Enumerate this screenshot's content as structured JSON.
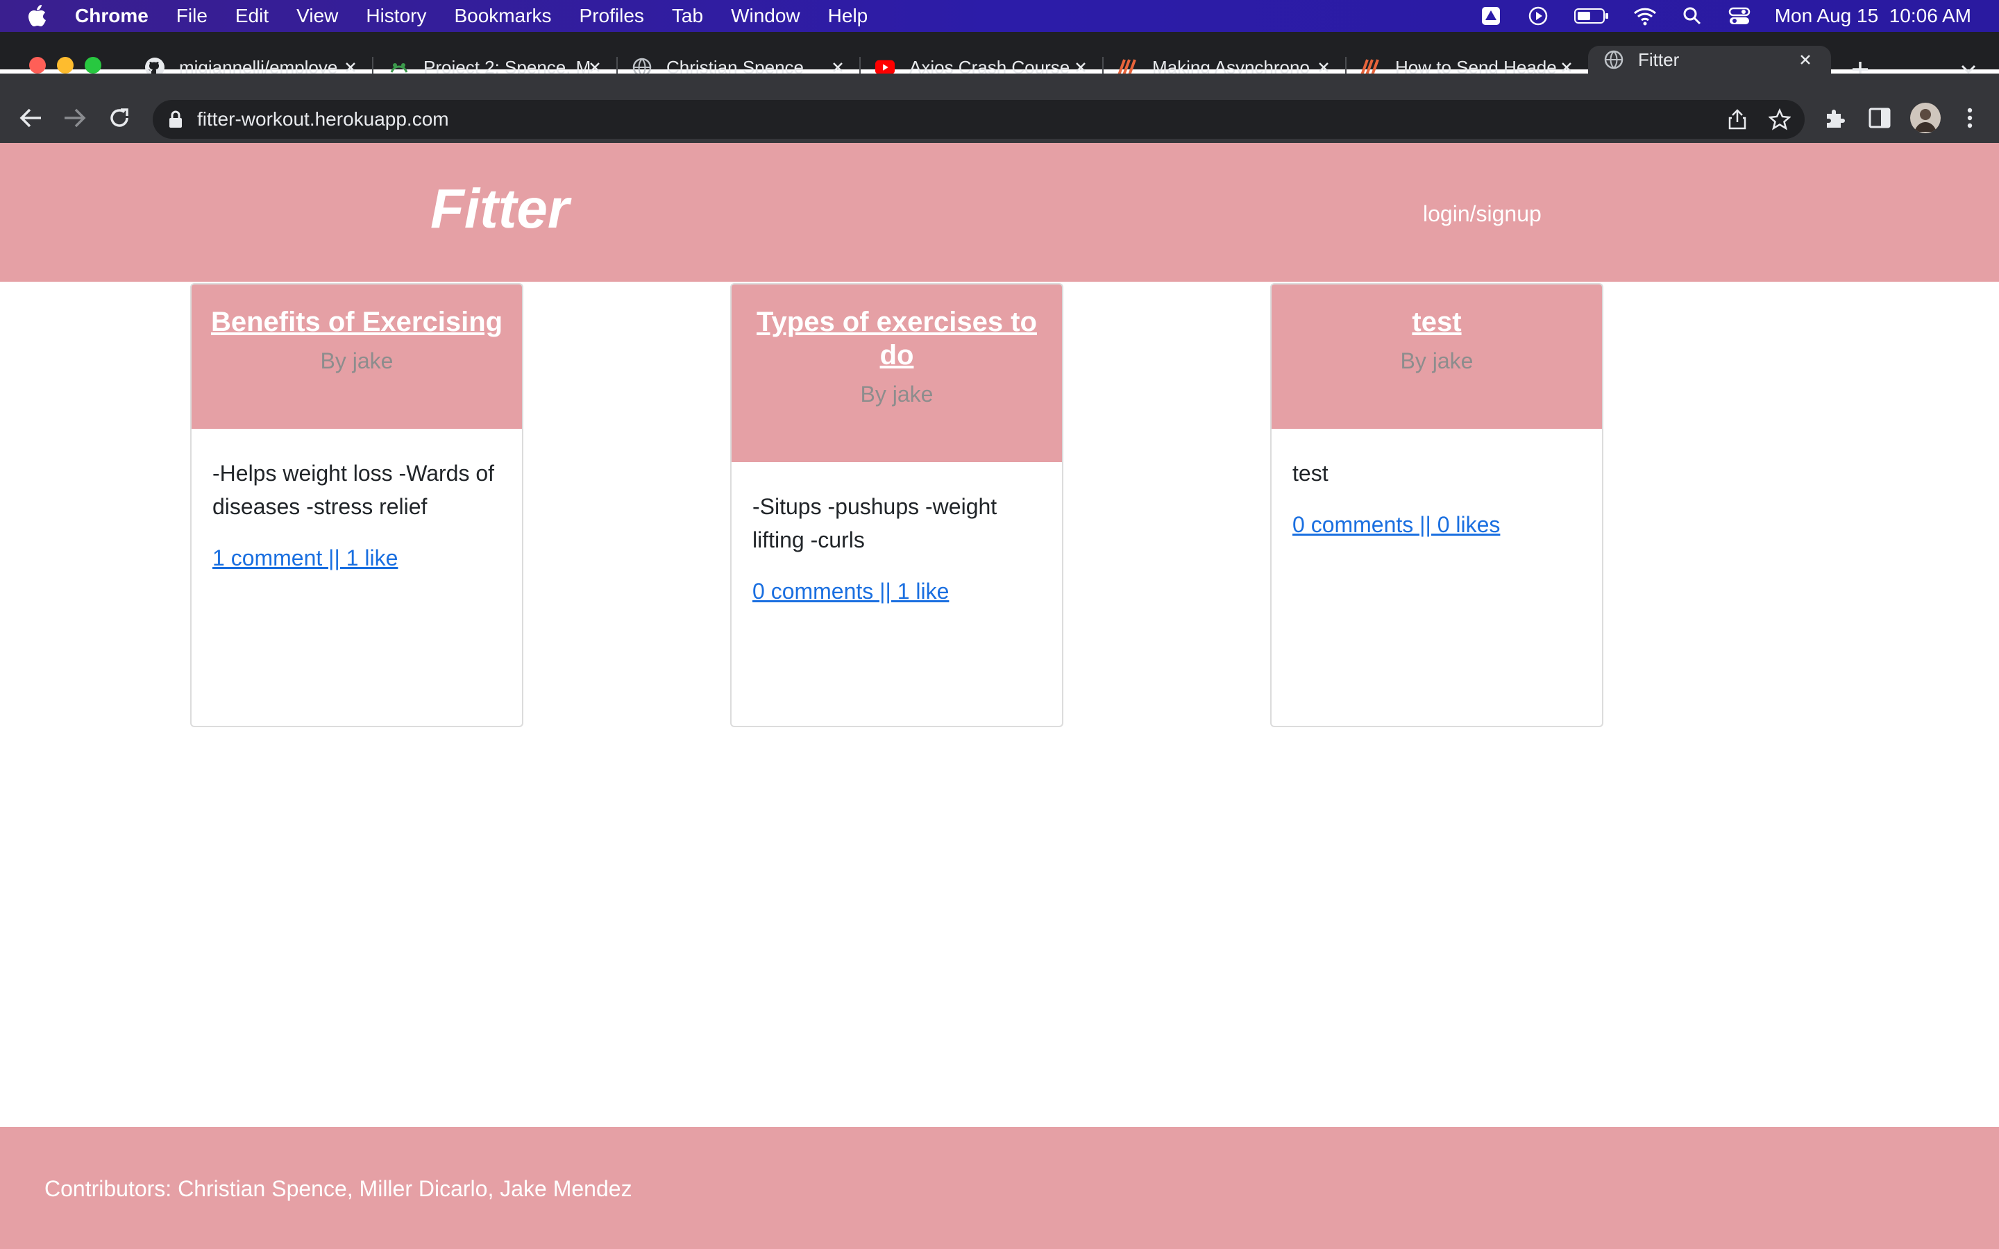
{
  "menubar": {
    "app": "Chrome",
    "items": [
      "File",
      "Edit",
      "View",
      "History",
      "Bookmarks",
      "Profiles",
      "Tab",
      "Window",
      "Help"
    ],
    "datetime": "Mon Aug 15  10:06 AM"
  },
  "tabs": [
    {
      "title": "mjgiannelli/employe",
      "icon": "github-icon"
    },
    {
      "title": "Project 2: Spence, M",
      "icon": "project-icon"
    },
    {
      "title": "Christian Spence",
      "icon": "globe-icon"
    },
    {
      "title": "Axios Crash Course",
      "icon": "youtube-icon"
    },
    {
      "title": "Making Asynchrono",
      "icon": "slash-icon"
    },
    {
      "title": "How to Send Heade",
      "icon": "slash-icon"
    },
    {
      "title": "Fitter",
      "icon": "globe-icon"
    }
  ],
  "browser": {
    "url": "fitter-workout.herokuapp.com"
  },
  "site": {
    "logo": "Fitter",
    "login": "login/signup",
    "posts": [
      {
        "title": "Benefits of Exercising",
        "author": "By jake",
        "body": "-Helps weight loss -Wards of diseases -stress relief",
        "meta": "1 comment || 1 like"
      },
      {
        "title": "Types of exercises to do",
        "author": "By jake",
        "body": "-Situps -pushups -weight lifting -curls",
        "meta": "0 comments || 1 like"
      },
      {
        "title": "test",
        "author": "By jake",
        "body": "test",
        "meta": "0 comments || 0 likes"
      }
    ],
    "footer": "Contributors: Christian Spence, Miller Dicarlo, Jake Mendez"
  },
  "colors": {
    "header_bg": "#e5a0a5",
    "link": "#1a6fe0",
    "chrome_dark": "#35363a"
  }
}
